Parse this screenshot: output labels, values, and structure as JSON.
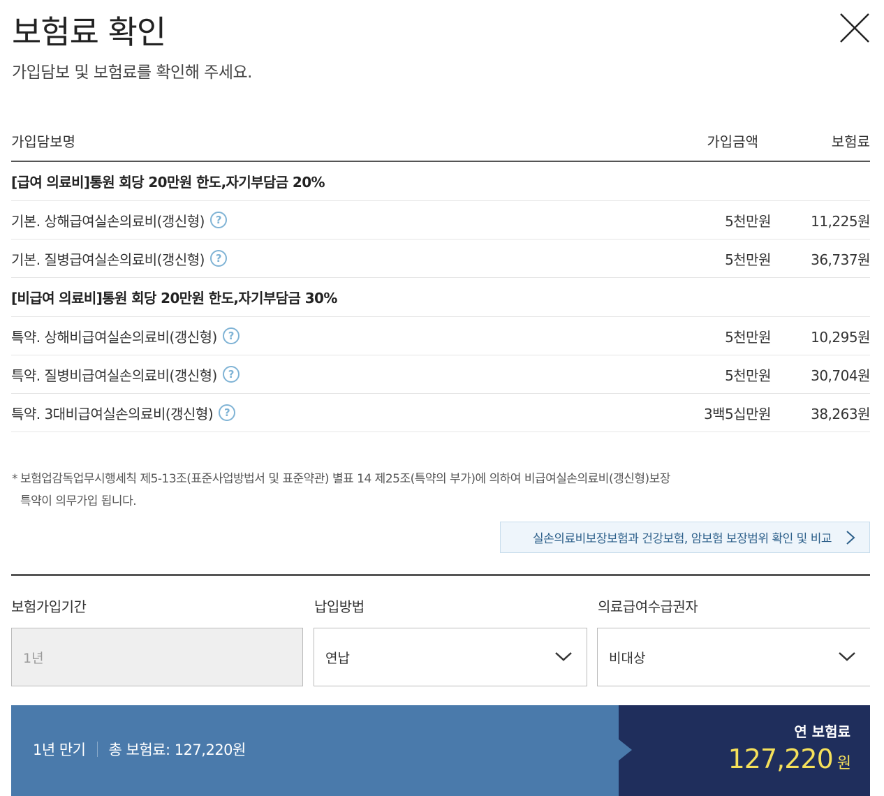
{
  "header": {
    "title": "보험료 확인",
    "subtitle": "가입담보 및 보험료를 확인해 주세요.",
    "close_icon": "close-icon"
  },
  "table": {
    "columns": [
      "가입담보명",
      "가입금액",
      "보험료"
    ],
    "groups": [
      {
        "title": "[급여 의료비]통원 회당 20만원 한도,자기부담금 20%",
        "rows": [
          {
            "name": "기본. 상해급여실손의료비(갱신형)",
            "amount": "5천만원",
            "premium": "11,225원"
          },
          {
            "name": "기본. 질병급여실손의료비(갱신형)",
            "amount": "5천만원",
            "premium": "36,737원"
          }
        ]
      },
      {
        "title": "[비급여 의료비]통원 회당 20만원 한도,자기부담금 30%",
        "rows": [
          {
            "name": "특약. 상해비급여실손의료비(갱신형)",
            "amount": "5천만원",
            "premium": "10,295원"
          },
          {
            "name": "특약. 질병비급여실손의료비(갱신형)",
            "amount": "5천만원",
            "premium": "30,704원"
          },
          {
            "name": "특약. 3대비급여실손의료비(갱신형)",
            "amount": "3백5십만원",
            "premium": "38,263원"
          }
        ]
      }
    ],
    "help_icon_glyph": "?"
  },
  "notice": {
    "star": "*",
    "line1": "보험업감독업무시행세칙 제5-13조(표준사업방법서 및 표준약관) 별표 14 제25조(특약의 부가)에 의하여 비급여실손의료비(갱신형)보장",
    "line2": "특약이 의무가입 됩니다."
  },
  "compare_button": {
    "label": "실손의료비보장보험과 건강보험, 암보험 보장범위 확인 및 비교"
  },
  "options": {
    "period": {
      "label": "보험가입기간",
      "value": "1년"
    },
    "payment": {
      "label": "납입방법",
      "value": "연납"
    },
    "medical_aid": {
      "label": "의료급여수급권자",
      "value": "비대상"
    }
  },
  "summary": {
    "term": "1년 만기",
    "total": "총 보험료: 127,220원",
    "annual_label": "연 보험료",
    "annual_value": "127,220",
    "annual_unit": "원"
  }
}
